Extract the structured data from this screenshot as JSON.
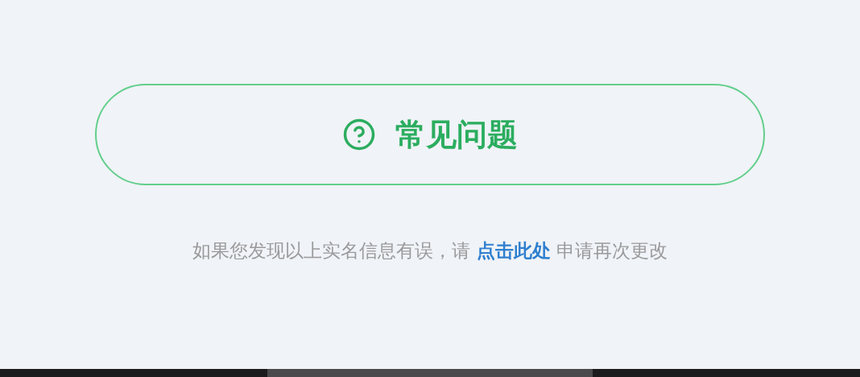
{
  "faq_button": {
    "label": "常见问题"
  },
  "notice": {
    "before": "如果您发现以上实名信息有误，请 ",
    "link": "点击此处",
    "after": " 申请再次更改"
  }
}
